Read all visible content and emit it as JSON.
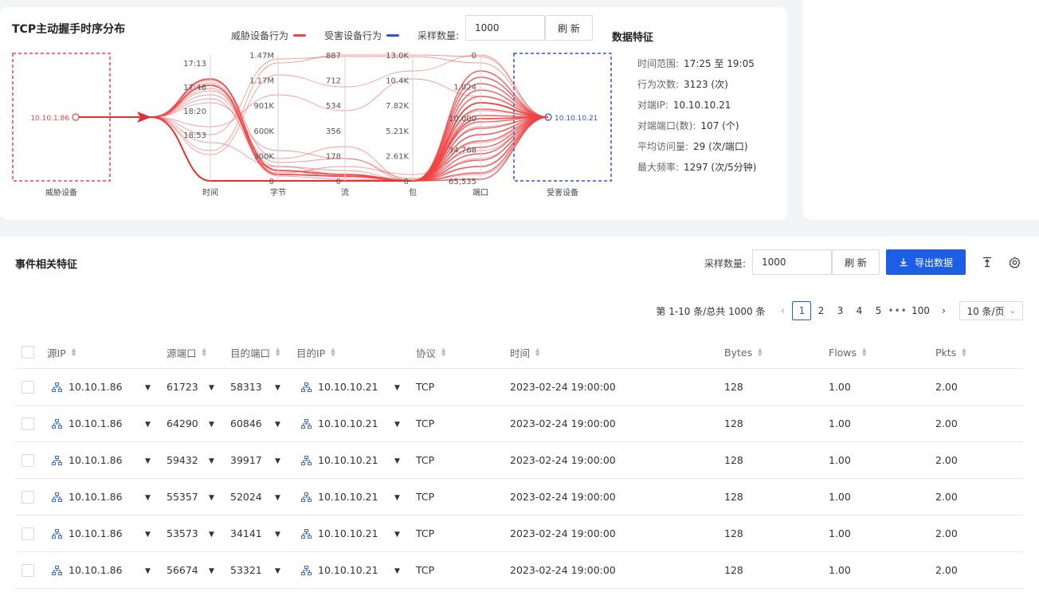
{
  "top_chart": {
    "title": "TCP主动握手时序分布",
    "legend": [
      {
        "label": "威胁设备行为",
        "color": "#f04343"
      },
      {
        "label": "受害设备行为",
        "color": "#2c55d6"
      }
    ],
    "sample_label": "采样数量:",
    "sample_value": "1000",
    "refresh_label": "刷 新"
  },
  "chart_data": {
    "type": "parallel-coordinates",
    "title": "TCP主动握手时序分布",
    "source_node": "10.10.1.86",
    "source_label": "威胁设备",
    "target_node": "10.10.10.21",
    "target_label": "受害设备",
    "axes": [
      {
        "name": "时间",
        "ticks": [
          "17:13",
          "17:46",
          "18:20",
          "18:53"
        ]
      },
      {
        "name": "字节",
        "ticks": [
          "1.47M",
          "1.17M",
          "901K",
          "600K",
          "300K",
          "0"
        ]
      },
      {
        "name": "流",
        "ticks": [
          "887",
          "712",
          "534",
          "356",
          "178",
          "0"
        ]
      },
      {
        "name": "包",
        "ticks": [
          "13.0K",
          "10.4K",
          "7.82K",
          "5.21K",
          "2.61K",
          "0"
        ]
      },
      {
        "name": "端口",
        "ticks": [
          "0",
          "1,024",
          "10,000",
          "34,768",
          "65,535"
        ]
      }
    ]
  },
  "features": {
    "title": "数据特征",
    "rows": [
      {
        "label": "时间范围:",
        "value": "17:25 至 19:05"
      },
      {
        "label": "行为次数:",
        "value": "3123 (次)"
      },
      {
        "label": "对端IP:",
        "value": "10.10.10.21"
      },
      {
        "label": "对端端口(数):",
        "value": "107 (个)"
      },
      {
        "label": "平均访问量:",
        "value": "29 (次/端口)"
      },
      {
        "label": "最大频率:",
        "value": "1297 (次/5分钟)"
      }
    ]
  },
  "events": {
    "title": "事件相关特征",
    "sample_label": "采样数量:",
    "sample_value": "1000",
    "refresh_label": "刷 新",
    "export_label": "导出数据",
    "pagination": {
      "total_text": "第 1-10 条/总共 1000 条",
      "pages": [
        "1",
        "2",
        "3",
        "4",
        "5"
      ],
      "ellipsis": "•••",
      "last_page": "100",
      "page_size": "10 条/页"
    },
    "columns": [
      "源IP",
      "源端口",
      "目的端口",
      "目的IP",
      "协议",
      "时间",
      "Bytes",
      "Flows",
      "Pkts"
    ],
    "rows": [
      {
        "src_ip": "10.10.1.86",
        "src_port": "61723",
        "dst_port": "58313",
        "dst_ip": "10.10.10.21",
        "proto": "TCP",
        "time": "2023-02-24 19:00:00",
        "bytes": "128",
        "flows": "1.00",
        "pkts": "2.00"
      },
      {
        "src_ip": "10.10.1.86",
        "src_port": "64290",
        "dst_port": "60846",
        "dst_ip": "10.10.10.21",
        "proto": "TCP",
        "time": "2023-02-24 19:00:00",
        "bytes": "128",
        "flows": "1.00",
        "pkts": "2.00"
      },
      {
        "src_ip": "10.10.1.86",
        "src_port": "59432",
        "dst_port": "39917",
        "dst_ip": "10.10.10.21",
        "proto": "TCP",
        "time": "2023-02-24 19:00:00",
        "bytes": "128",
        "flows": "1.00",
        "pkts": "2.00"
      },
      {
        "src_ip": "10.10.1.86",
        "src_port": "55357",
        "dst_port": "52024",
        "dst_ip": "10.10.10.21",
        "proto": "TCP",
        "time": "2023-02-24 19:00:00",
        "bytes": "128",
        "flows": "1.00",
        "pkts": "2.00"
      },
      {
        "src_ip": "10.10.1.86",
        "src_port": "53573",
        "dst_port": "34141",
        "dst_ip": "10.10.10.21",
        "proto": "TCP",
        "time": "2023-02-24 19:00:00",
        "bytes": "128",
        "flows": "1.00",
        "pkts": "2.00"
      },
      {
        "src_ip": "10.10.1.86",
        "src_port": "56674",
        "dst_port": "53321",
        "dst_ip": "10.10.10.21",
        "proto": "TCP",
        "time": "2023-02-24 19:00:00",
        "bytes": "128",
        "flows": "1.00",
        "pkts": "2.00"
      }
    ]
  }
}
